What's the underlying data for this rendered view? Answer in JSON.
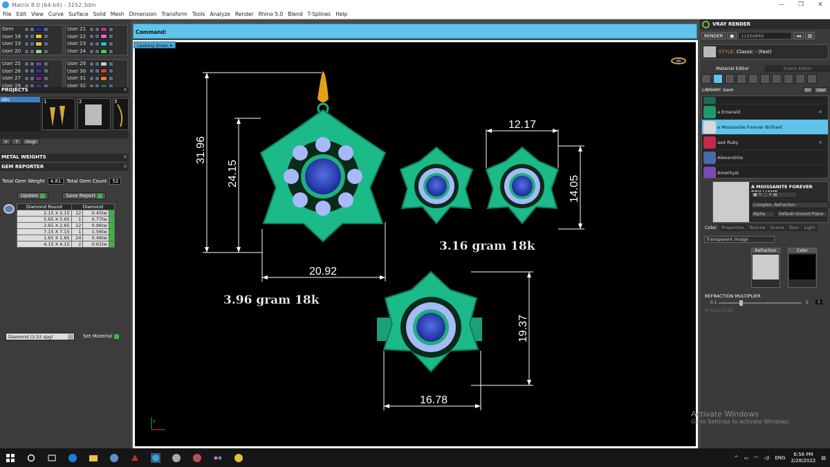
{
  "window": {
    "title": "Matrix 8.0 (64-bit) - 3152.3dm",
    "controls": [
      "—",
      "❐",
      "✕"
    ]
  },
  "menu": [
    "File",
    "Edit",
    "View",
    "Curve",
    "Surface",
    "Solid",
    "Mesh",
    "Dimension",
    "Transform",
    "Tools",
    "Analyze",
    "Render",
    "Rhino 5.0",
    "Blend",
    "T-Splines",
    "Help"
  ],
  "layers": {
    "left": [
      {
        "name": "Gem",
        "color": "#1f2bb8"
      },
      {
        "name": "User 18",
        "color": "#f0c23a"
      },
      {
        "name": "User 19",
        "color": "#d9c15b"
      },
      {
        "name": "User 20",
        "color": "#8fd08c"
      },
      {
        "name": "User 25",
        "color": "#6c3fb5"
      },
      {
        "name": "User 26",
        "color": "#2a3aa0"
      },
      {
        "name": "User 27",
        "color": "#6b2c8a"
      },
      {
        "name": "User 28",
        "color": "#4a2a7a"
      }
    ],
    "right": [
      {
        "name": "User 21",
        "color": "#b23a8a"
      },
      {
        "name": "User 22",
        "color": "#e06ac6"
      },
      {
        "name": "User 23",
        "color": "#37b2e0"
      },
      {
        "name": "User 24",
        "color": "#33d94a"
      },
      {
        "name": "User 29",
        "color": "#c9c9c9"
      },
      {
        "name": "User 30",
        "color": "#dd3a3a"
      },
      {
        "name": "User 31",
        "color": "#f07a1a"
      },
      {
        "name": "User 32",
        "color": "#1c6c4a"
      }
    ]
  },
  "projects": {
    "header": "PROJECTS",
    "list_selected": "abc",
    "thumbs": [
      "1",
      "2",
      "3"
    ],
    "tools": [
      "+",
      "↑",
      "Hngr"
    ]
  },
  "panels": {
    "metal_weights": "METAL WEIGHTS",
    "gem_reporter": "GEM REPORTER"
  },
  "gem_reporter": {
    "total_weight_label": "Total Gem Weight",
    "total_weight_value": "4.81",
    "total_count_label": "Total Gem Count",
    "total_count_value": "52",
    "update_label": "Update",
    "save_report_label": "Save Report",
    "columns": [
      "Diamond Round",
      "Diamond"
    ],
    "rows": [
      {
        "size": "2.15 X 2.15",
        "count": "12",
        "weight": "0.45tw"
      },
      {
        "size": "5.65 X 5.65",
        "count": "1",
        "weight": "0.77tw"
      },
      {
        "size": "2.65 X 2.65",
        "count": "12",
        "weight": "0.96tw"
      },
      {
        "size": "7.15 X 7.15",
        "count": "1",
        "weight": "1.56tw"
      },
      {
        "size": "1.65 X 1.65",
        "count": "24",
        "weight": "0.46tw"
      },
      {
        "size": "4.15 X 4.15",
        "count": "2",
        "weight": "0.61tw"
      }
    ],
    "material_select": "Diamond      (3.52 spg)",
    "set_material_label": "Set Material"
  },
  "command": {
    "label": "Command:"
  },
  "viewport": {
    "view_label": "Looking Down",
    "dims": {
      "pendant_height": "31.96",
      "pendant_body": "24.15",
      "pendant_width": "20.92",
      "earring_width": "12.17",
      "earring_height": "14.05",
      "ring_height": "19.37",
      "ring_width": "16.78"
    },
    "weights": {
      "pendant": "3.96 gram 18k",
      "earrings": "3.16 gram 18k"
    },
    "axis": "z"
  },
  "vray": {
    "title": "VRAY RENDER",
    "render_label": "RENDER",
    "render_size": "1120x840",
    "style_prefix": "STYLE:",
    "style_value": "Classic - (Fast)",
    "tabs": [
      "Material Editor",
      "Scene Editor"
    ],
    "library_label": "LIBRARY: Gem",
    "library_btns": [
      "GV",
      "User"
    ],
    "materials": [
      {
        "name": "a Emerald",
        "color": "#1e9a6a"
      },
      {
        "name": "a Moissanite Forever Brilliant",
        "color": "#d8d8d8",
        "selected": true
      },
      {
        "name": "aa4 Ruby",
        "color": "#c42a4a"
      },
      {
        "name": "Alexandrite",
        "color": "#4a6ab0"
      },
      {
        "name": "Amethyst",
        "color": "#7a4ab8"
      }
    ],
    "preview_name": "A MOISSANITE FOREVER BRILLIANT",
    "preview_field1": "Complex- Refraction",
    "preview_alpha": "Alpha",
    "preview_ground": "Default Ground Plane",
    "subtabs": [
      "Color",
      "Properties",
      "Texture",
      "Scene",
      "Toon",
      "Light"
    ],
    "transp_select": "Transparent Image",
    "refraction_label": "Refraction",
    "color_label": "Color",
    "refr_mult_label": "REFRACTION MULTIPLIER",
    "slider_min": "0.1",
    "slider_max": "5",
    "slider_val": "1",
    "slider2_label": "IR MULTIPLIER"
  },
  "activation": {
    "line1": "Activate Windows",
    "line2": "Go to Settings to activate Windows."
  },
  "taskbar": {
    "lang": "ENG",
    "time": "6:56 PM",
    "date": "2/28/2022"
  }
}
